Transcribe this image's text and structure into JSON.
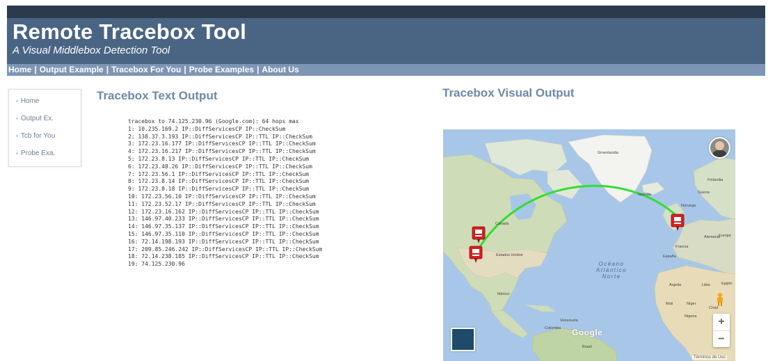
{
  "header": {
    "title": "Remote Tracebox Tool",
    "subtitle": "A Visual Middlebox Detection Tool"
  },
  "nav": {
    "items": [
      "Home",
      "Output Example",
      "Tracebox For You",
      "Probe Examples",
      "About Us"
    ],
    "separator": "|"
  },
  "sidebar": {
    "items": [
      "Home",
      "Output Ex.",
      "Tcb for You",
      "Probe Exa."
    ]
  },
  "text_output": {
    "title": "Tracebox Text Output",
    "lines": [
      "tracebox to 74.125.230.96 (Google.com): 64 hops max",
      "1: 10.235.169.2 IP::DiffServicesCP IP::CheckSum",
      "2: 138.37.3.193 IP::DiffServicesCP IP::TTL IP::CheckSum",
      "3: 172.23.16.177 IP::DiffServicesCP IP::TTL IP::CheckSum",
      "4: 172.23.16.217 IP::DiffServicesCP IP::TTL IP::CheckSum",
      "5: 172.23.8.13 IP::DiffServicesCP IP::TTL IP::CheckSum",
      "6: 172.23.48.26 IP::DiffServicesCP IP::TTL IP::CheckSum",
      "7: 172.23.56.1 IP::DiffServicesCP IP::TTL IP::CheckSum",
      "8: 172.23.8.14 IP::DiffServicesCP IP::TTL IP::CheckSum",
      "9: 172.23.8.18 IP::DiffServicesCP IP::TTL IP::CheckSum",
      "10: 172.23.56.10 IP::DiffServicesCP IP::TTL IP::CheckSum",
      "11: 172.23.52.17 IP::DiffServicesCP IP::TTL IP::CheckSum",
      "12: 172.23.16.162 IP::DiffServicesCP IP::TTL IP::CheckSum",
      "13: 146.97.40.233 IP::DiffServicesCP IP::TTL IP::CheckSum",
      "14: 146.97.35.137 IP::DiffServicesCP IP::TTL IP::CheckSum",
      "15: 146.97.35.110 IP::DiffServicesCP IP::TTL IP::CheckSum",
      "16: 72.14.198.193 IP::DiffServicesCP IP::TTL IP::CheckSum",
      "17: 209.85.246.242 IP::DiffServicesCP IP::TTL IP::CheckSum",
      "18: 72.14.238.185 IP::DiffServicesCP IP::TTL IP::CheckSum",
      "19: 74.125.230.96"
    ]
  },
  "visual_output": {
    "title": "Tracebox Visual Output",
    "map": {
      "labels": {
        "greenland": "Groenlandia",
        "iceland": "Islandia",
        "canada": "Canadá",
        "usa": "Estados Unidos",
        "mexico": "México",
        "venezuela": "Venezuela",
        "colombia": "Colombia",
        "brasil": "Brasil",
        "ocean": "Océano Atlántico Norte",
        "finland": "Finlandia",
        "sweden": "Suecia",
        "norway": "Noruega",
        "germany": "Alemania",
        "france": "Francia",
        "spain": "España",
        "algeria": "Argelia",
        "libya": "Libia",
        "egypt": "Egipto",
        "mali": "Mali",
        "niger": "Níger",
        "chad": "Chad",
        "nigeria": "Nigeria",
        "europe": "Europa"
      },
      "google_logo": "Google",
      "terms": "Términos de Uso",
      "zoom_in": "+",
      "zoom_out": "−",
      "route_color": "#33dd33",
      "marker_color": "#d42020"
    }
  }
}
